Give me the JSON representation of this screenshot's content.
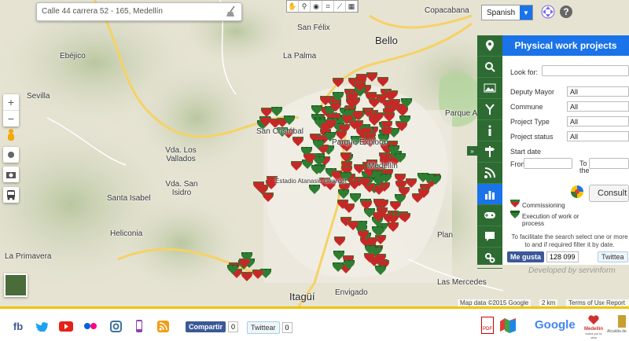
{
  "search": {
    "value": "Calle 44 carrera 52 - 165, Medellín"
  },
  "tools": [
    "✋",
    "⚲",
    "◉",
    "⌗",
    "⟋",
    "▦"
  ],
  "language": {
    "selected": "Spanish"
  },
  "places": [
    {
      "label": "San Félix"
    },
    {
      "label": "Bello",
      "big": true
    },
    {
      "label": "Copacabana"
    },
    {
      "label": "La Palma"
    },
    {
      "label": "Ebéjico"
    },
    {
      "label": "Sevilla"
    },
    {
      "label": "Parque Arví"
    },
    {
      "label": "San Cristóbal"
    },
    {
      "label": "Parque Explora"
    },
    {
      "label": "Vda. Los Vallados"
    },
    {
      "label": "Vda. San Isidro"
    },
    {
      "label": "Santa Isabel"
    },
    {
      "label": "Heliconia"
    },
    {
      "label": "La Primavera"
    },
    {
      "label": "Plan"
    },
    {
      "label": "Las Mercedes"
    },
    {
      "label": "Itagüí",
      "big": true
    },
    {
      "label": "Envigado"
    },
    {
      "label": "Medellín"
    },
    {
      "label": "Estadio Atanasio Girardot"
    }
  ],
  "panel": {
    "title": "Physical work projects",
    "look_for_label": "Look for:",
    "look_for_value": "",
    "fields": [
      {
        "label": "Deputy Mayor",
        "value": "All"
      },
      {
        "label": "Commune",
        "value": "All"
      },
      {
        "label": "Project Type",
        "value": "All"
      },
      {
        "label": "Project status",
        "value": "All"
      }
    ],
    "start_date_label": "Start date",
    "from_label": "From",
    "to_label": "To the",
    "consult_label": "Consult",
    "legend": [
      {
        "label": "Commissioning"
      },
      {
        "label": "Execution of work or process"
      }
    ],
    "hint": "To facilitate the search select one or more to and if required filter it by date.",
    "fb_like": "Me gusta",
    "fb_count": "128 099",
    "tweet": "Twittea"
  },
  "developed_by": "Developed by servinform",
  "attribution": {
    "data": "Map data ©2015 Google",
    "scale": "2 km",
    "terms": "Terms of Use",
    "report": "Report a b"
  },
  "footer": {
    "share_label": "Compartir",
    "share_count": "0",
    "tweet_label": "Twittear",
    "tweet_count": "0",
    "pdf_label": "PDF",
    "google_text": "Google",
    "medellin_text": "Medellín",
    "medellin_sub": "todos por la vida",
    "alcaldia_text": "Alcaldía de"
  },
  "colors": {
    "commissioning": "#c62828",
    "execution": "#2e7d32",
    "accent": "#1a73e8",
    "panel_green": "#2e6b33"
  }
}
